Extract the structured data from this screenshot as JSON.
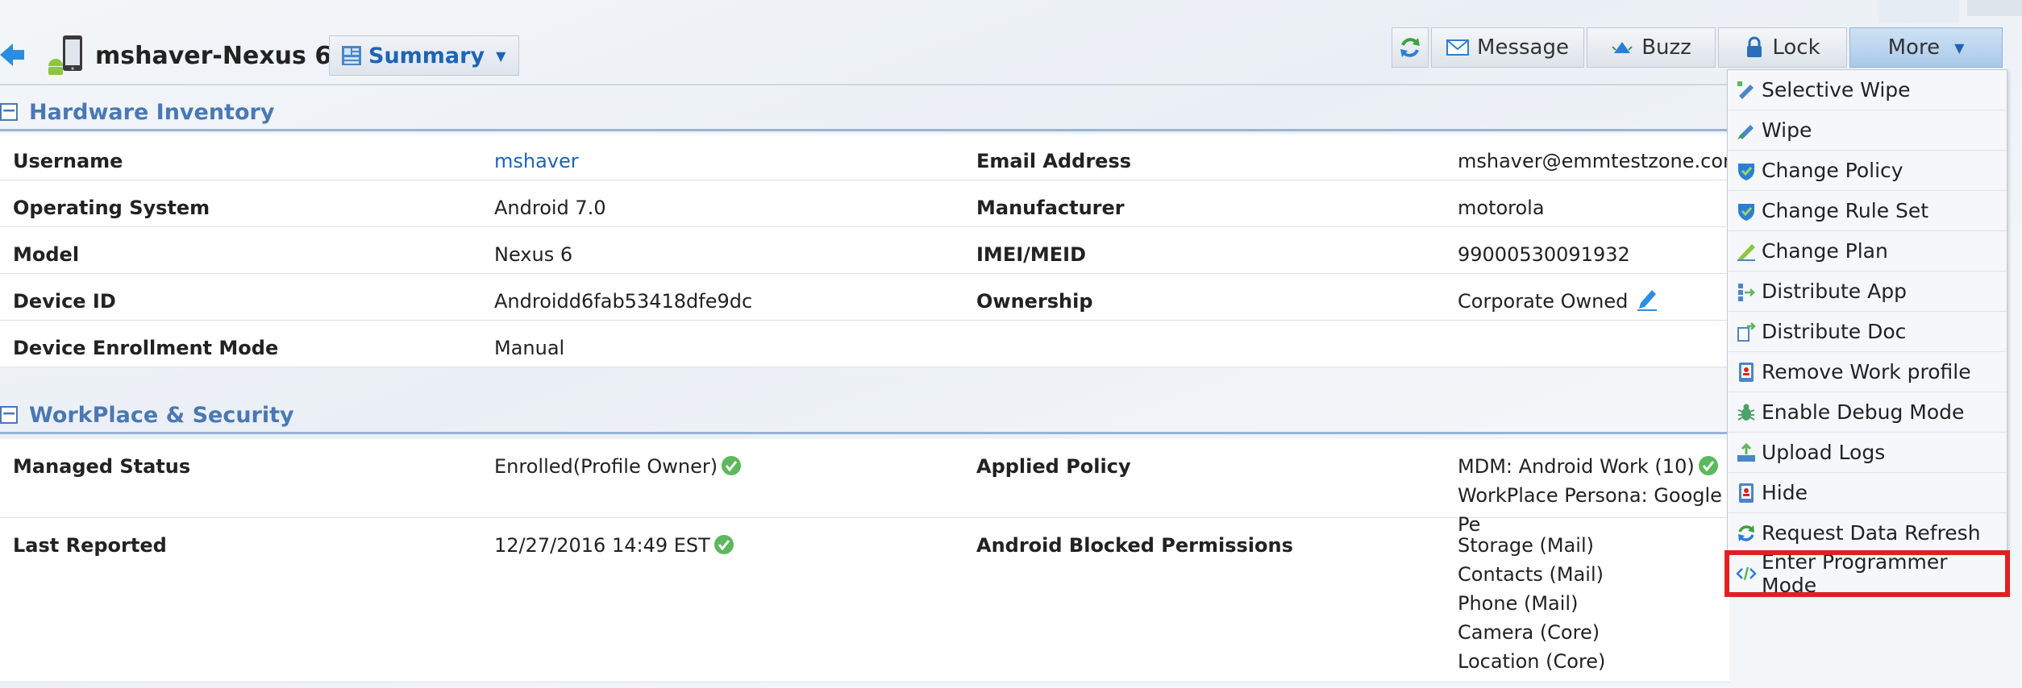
{
  "header": {
    "device_name": "mshaver-Nexus 6",
    "view_selector": "Summary"
  },
  "toolbar": {
    "message": "Message",
    "buzz": "Buzz",
    "lock": "Lock",
    "more": "More"
  },
  "more_menu": {
    "items": [
      {
        "label": "Selective Wipe",
        "icon": "selective-wipe-icon"
      },
      {
        "label": "Wipe",
        "icon": "wipe-icon"
      },
      {
        "label": "Change Policy",
        "icon": "policy-shield-icon"
      },
      {
        "label": "Change Rule Set",
        "icon": "rule-set-shield-icon"
      },
      {
        "label": "Change Plan",
        "icon": "plan-icon"
      },
      {
        "label": "Distribute App",
        "icon": "distribute-app-icon"
      },
      {
        "label": "Distribute Doc",
        "icon": "distribute-doc-icon"
      },
      {
        "label": "Remove Work profile",
        "icon": "remove-work-profile-icon"
      },
      {
        "label": "Enable Debug Mode",
        "icon": "debug-bug-icon"
      },
      {
        "label": "Upload Logs",
        "icon": "upload-logs-icon"
      },
      {
        "label": "Hide",
        "icon": "hide-icon"
      },
      {
        "label": "Request Data Refresh",
        "icon": "refresh-icon"
      },
      {
        "label": "Enter Programmer Mode",
        "icon": "code-brackets-icon"
      }
    ],
    "highlight_color": "#e02020"
  },
  "hardware_inventory": {
    "title": "Hardware Inventory",
    "rows": [
      {
        "label1": "Username",
        "value1": "mshaver",
        "label2": "Email Address",
        "value2": "mshaver@emmtestzone.com"
      },
      {
        "label1": "Operating System",
        "value1": "Android 7.0",
        "label2": "Manufacturer",
        "value2": "motorola"
      },
      {
        "label1": "Model",
        "value1": "Nexus 6",
        "label2": "IMEI/MEID",
        "value2": "99000530091932"
      },
      {
        "label1": "Device ID",
        "value1": "Androidd6fab53418dfe9dc",
        "label2": "Ownership",
        "value2": "Corporate Owned"
      },
      {
        "label1": "Device Enrollment Mode",
        "value1": "Manual",
        "label2": "",
        "value2": ""
      }
    ]
  },
  "workplace_security": {
    "title": "WorkPlace & Security",
    "managed_status_label": "Managed Status",
    "managed_status_value": "Enrolled(Profile Owner)",
    "applied_policy_label": "Applied Policy",
    "applied_policy_values": [
      "MDM: Android Work (10)",
      "WorkPlace Persona: Google Pe"
    ],
    "last_reported_label": "Last Reported",
    "last_reported_value": "12/27/2016 14:49 EST",
    "blocked_permissions_label": "Android Blocked Permissions",
    "blocked_permissions": [
      "Storage (Mail)",
      "Contacts (Mail)",
      "Phone (Mail)",
      "Camera (Core)",
      "Location (Core)"
    ]
  },
  "colors": {
    "accent": "#4a78b3",
    "link": "#1e64b4",
    "ok_green": "#5cb85c"
  }
}
